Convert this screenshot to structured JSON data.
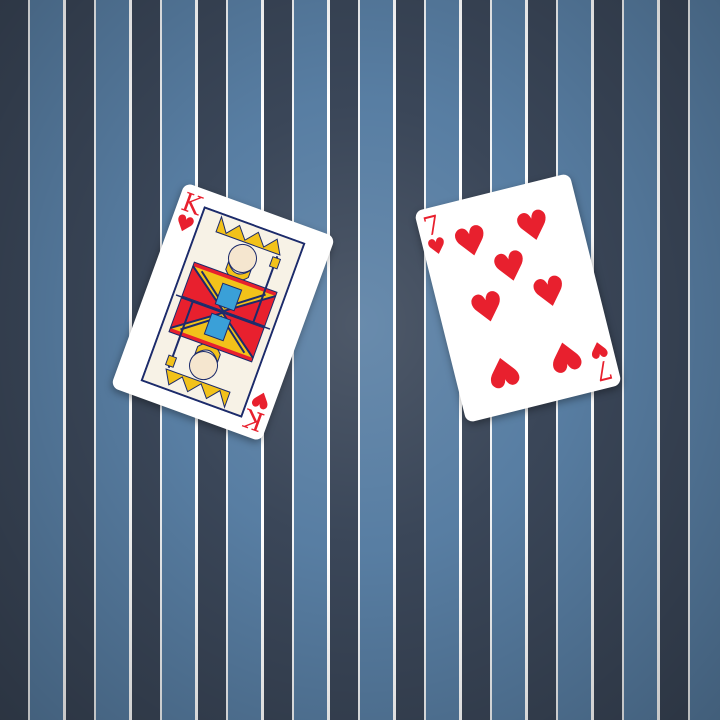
{
  "colors": {
    "stripe_dark": "#3a4658",
    "stripe_light": "#587ea3",
    "suit_red": "#e8202e"
  },
  "cards": [
    {
      "rank": "K",
      "suit": "♥",
      "suit_name": "hearts"
    },
    {
      "rank": "7",
      "suit": "♥",
      "suit_name": "hearts"
    }
  ]
}
